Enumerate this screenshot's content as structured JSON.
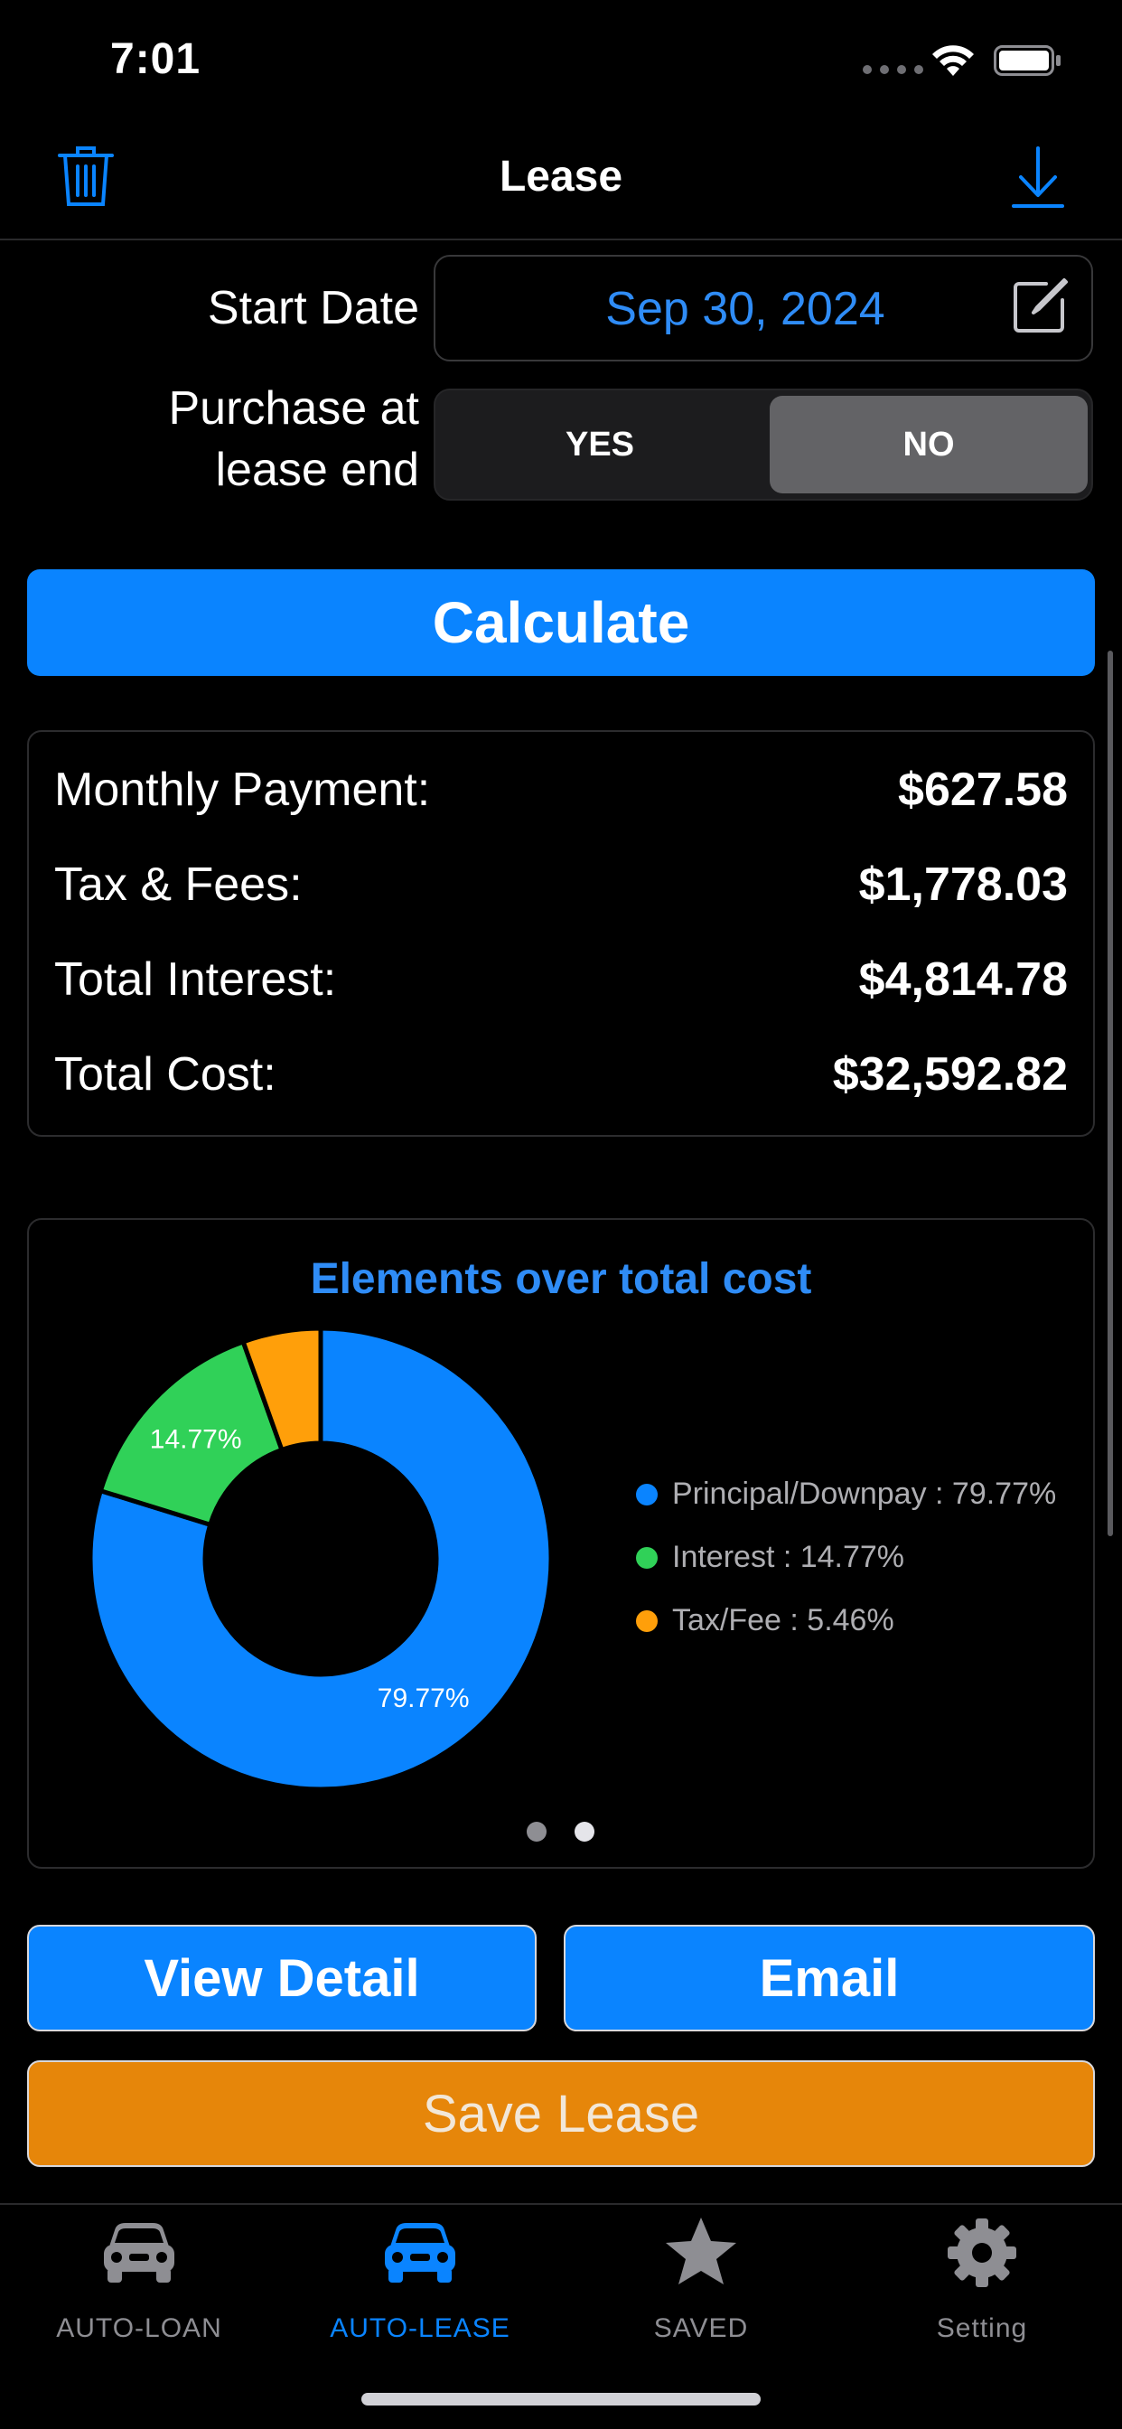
{
  "status": {
    "time": "7:01"
  },
  "nav": {
    "title": "Lease"
  },
  "form": {
    "start_label": "Start Date",
    "start_value": "Sep 30, 2024",
    "purchase_label_line1": "Purchase at",
    "purchase_label_line2": "lease end",
    "yes": "YES",
    "no": "NO",
    "selected": "NO"
  },
  "calculate_label": "Calculate",
  "results": [
    {
      "label": "Monthly Payment:",
      "value": "$627.58"
    },
    {
      "label": "Tax & Fees:",
      "value": "$1,778.03"
    },
    {
      "label": "Total Interest:",
      "value": "$4,814.78"
    },
    {
      "label": "Total Cost:",
      "value": "$32,592.82"
    }
  ],
  "chart_data": {
    "type": "pie",
    "title": "Elements over total cost",
    "categories": [
      "Principal/Downpay",
      "Interest",
      "Tax/Fee"
    ],
    "values": [
      79.77,
      14.77,
      5.46
    ],
    "slice_labels": [
      "79.77%",
      "14.77%",
      ""
    ],
    "legend": [
      "Principal/Downpay : 79.77%",
      "Interest : 14.77%",
      "Tax/Fee : 5.46%"
    ],
    "colors": [
      "#0a84ff",
      "#30d158",
      "#ff9f0a"
    ],
    "legend_position": "right",
    "donut": true
  },
  "pager": {
    "count": 2,
    "active": 1
  },
  "buttons": {
    "view_detail": "View Detail",
    "email": "Email",
    "save": "Save Lease"
  },
  "tabs": [
    {
      "label": "AUTO-LOAN",
      "icon": "car-icon"
    },
    {
      "label": "AUTO-LEASE",
      "icon": "car-icon",
      "active": true
    },
    {
      "label": "SAVED",
      "icon": "star-icon"
    },
    {
      "label": "Setting",
      "icon": "gear-icon"
    }
  ],
  "colors": {
    "accent": "#0a84ff",
    "save": "#e6860a"
  }
}
